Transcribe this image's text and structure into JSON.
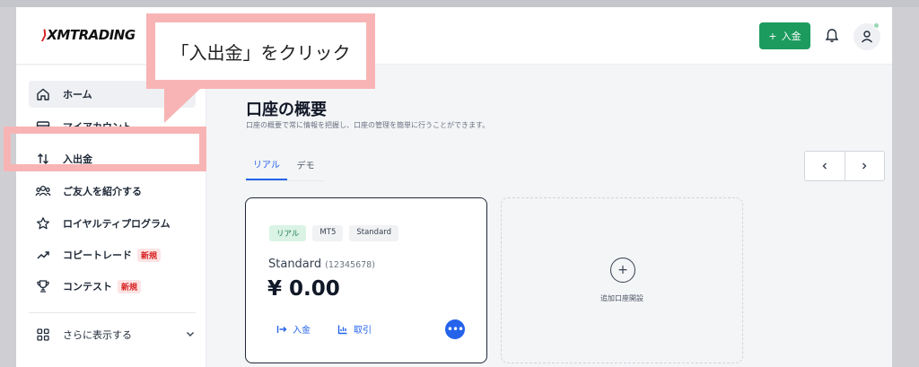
{
  "brand": {
    "logo_text": "XMTRADING",
    "accent": "#d81e1e",
    "green": "#1d9b5f",
    "blue": "#2563eb"
  },
  "header": {
    "deposit_button": "入金",
    "bell_icon": "bell-icon",
    "avatar_icon": "user-icon"
  },
  "callout": {
    "text": "「入出金」をクリック"
  },
  "sidebar": {
    "items": [
      {
        "label": "ホーム",
        "icon": "home-icon"
      },
      {
        "label": "マイアカウント",
        "icon": "card-icon"
      },
      {
        "label": "入出金",
        "icon": "arrows-icon"
      },
      {
        "label": "ご友人を紹介する",
        "icon": "people-icon"
      },
      {
        "label": "ロイヤルティプログラム",
        "icon": "star-icon"
      },
      {
        "label": "コピートレード",
        "icon": "trend-icon",
        "badge": "新規"
      },
      {
        "label": "コンテスト",
        "icon": "trophy-icon",
        "badge": "新規"
      }
    ],
    "more": {
      "label": "さらに表示する",
      "icon": "grid-icon"
    }
  },
  "main": {
    "title": "口座の概要",
    "subtitle": "口座の概要で常に情報を把握し、口座の管理を簡単に行うことができます。",
    "tabs": [
      {
        "label": "リアル",
        "active": true
      },
      {
        "label": "デモ",
        "active": false
      }
    ],
    "pager": {
      "prev": "‹",
      "next": "›"
    }
  },
  "account_card": {
    "tags": [
      "リアル",
      "MT5",
      "Standard"
    ],
    "name": "Standard",
    "number": "(12345678)",
    "balance": "¥ 0.00",
    "deposit": "入金",
    "trade": "取引",
    "more": "•••"
  },
  "add_card": {
    "label": "追加口座開設"
  }
}
